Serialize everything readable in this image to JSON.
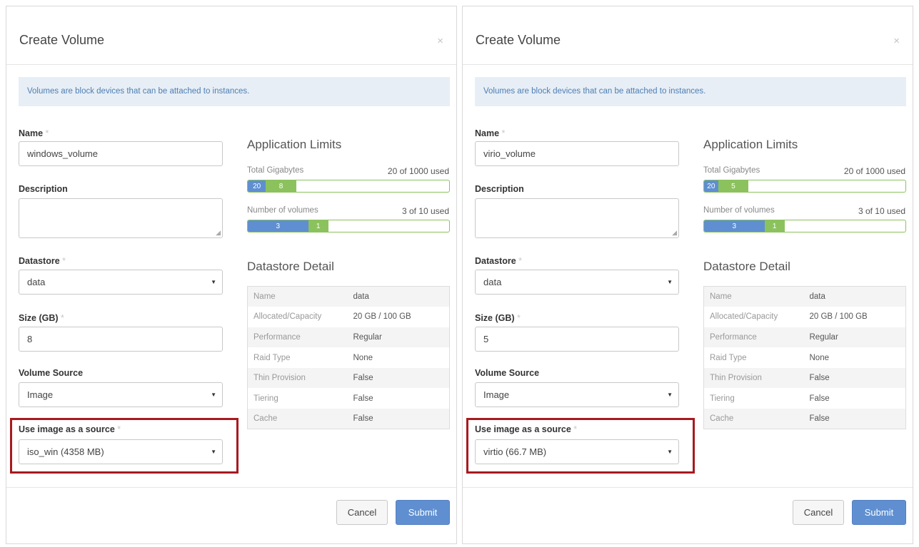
{
  "modals": [
    {
      "title": "Create Volume",
      "close_glyph": "×",
      "info": "Volumes are block devices that can be attached to instances.",
      "form": {
        "name_label": "Name",
        "name_value": "windows_volume",
        "description_label": "Description",
        "description_value": "",
        "datastore_label": "Datastore",
        "datastore_value": "data",
        "size_label": "Size (GB)",
        "size_value": "8",
        "volume_source_label": "Volume Source",
        "volume_source_value": "Image",
        "image_source_label": "Use image as a source",
        "image_source_value": "iso_win (4358 MB)"
      },
      "limits": {
        "title": "Application Limits",
        "gigabytes_label": "Total Gigabytes",
        "gigabytes_value": "20 of 1000 used",
        "gigabytes_used": "20",
        "gigabytes_new": "8",
        "volumes_label": "Number of volumes",
        "volumes_value": "3 of 10 used",
        "volumes_used": "3",
        "volumes_new": "1"
      },
      "datastore_detail": {
        "title": "Datastore Detail",
        "rows": [
          {
            "k": "Name",
            "v": "data"
          },
          {
            "k": "Allocated/Capacity",
            "v": "20 GB / 100 GB"
          },
          {
            "k": "Performance",
            "v": "Regular"
          },
          {
            "k": "Raid Type",
            "v": "None"
          },
          {
            "k": "Thin Provision",
            "v": "False"
          },
          {
            "k": "Tiering",
            "v": "False"
          },
          {
            "k": "Cache",
            "v": "False"
          }
        ]
      },
      "buttons": {
        "cancel": "Cancel",
        "submit": "Submit"
      }
    },
    {
      "title": "Create Volume",
      "close_glyph": "×",
      "info": "Volumes are block devices that can be attached to instances.",
      "form": {
        "name_label": "Name",
        "name_value": "virio_volume",
        "description_label": "Description",
        "description_value": "",
        "datastore_label": "Datastore",
        "datastore_value": "data",
        "size_label": "Size (GB)",
        "size_value": "5",
        "volume_source_label": "Volume Source",
        "volume_source_value": "Image",
        "image_source_label": "Use image as a source",
        "image_source_value": "virtio (66.7 MB)"
      },
      "limits": {
        "title": "Application Limits",
        "gigabytes_label": "Total Gigabytes",
        "gigabytes_value": "20 of 1000 used",
        "gigabytes_used": "20",
        "gigabytes_new": "5",
        "volumes_label": "Number of volumes",
        "volumes_value": "3 of 10 used",
        "volumes_used": "3",
        "volumes_new": "1"
      },
      "datastore_detail": {
        "title": "Datastore Detail",
        "rows": [
          {
            "k": "Name",
            "v": "data"
          },
          {
            "k": "Allocated/Capacity",
            "v": "20 GB / 100 GB"
          },
          {
            "k": "Performance",
            "v": "Regular"
          },
          {
            "k": "Raid Type",
            "v": "None"
          },
          {
            "k": "Thin Provision",
            "v": "False"
          },
          {
            "k": "Tiering",
            "v": "False"
          },
          {
            "k": "Cache",
            "v": "False"
          }
        ]
      },
      "buttons": {
        "cancel": "Cancel",
        "submit": "Submit"
      }
    }
  ],
  "progress": {
    "gigabytes": [
      {
        "used_fraction": 0.09,
        "new_fraction": 0.15
      },
      {
        "used_fraction": 0.07,
        "new_fraction": 0.15
      }
    ],
    "volumes": [
      {
        "used_fraction": 0.3,
        "new_fraction": 0.1
      },
      {
        "used_fraction": 0.3,
        "new_fraction": 0.1
      }
    ]
  },
  "colors": {
    "accent_blue": "#5f8fd0",
    "accent_green": "#8cc25e",
    "highlight_red": "#a71a1f",
    "info_bg": "#e7eef6"
  },
  "icons": {
    "close": "close-icon",
    "select_caret": "chevron-down-icon",
    "textarea_resize": "resize-handle-icon"
  }
}
